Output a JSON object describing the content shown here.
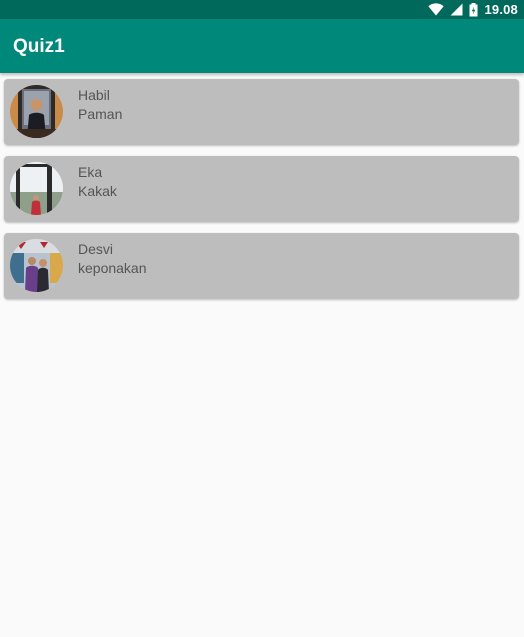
{
  "status_bar": {
    "time": "19.08",
    "icons": [
      "wifi-icon",
      "signal-icon",
      "battery-icon"
    ],
    "color": "#00695c"
  },
  "app_bar": {
    "title": "Quiz1",
    "color": "#00897b"
  },
  "contacts": [
    {
      "name": "Habil",
      "relation": "Paman",
      "avatar_icon": "avatar-photo-habil"
    },
    {
      "name": "Eka",
      "relation": "Kakak",
      "avatar_icon": "avatar-photo-eka"
    },
    {
      "name": "Desvi",
      "relation": "keponakan",
      "avatar_icon": "avatar-photo-desvi"
    }
  ],
  "colors": {
    "card_background": "#bdbdbd",
    "page_background": "#fafafa",
    "text": "#555555"
  }
}
